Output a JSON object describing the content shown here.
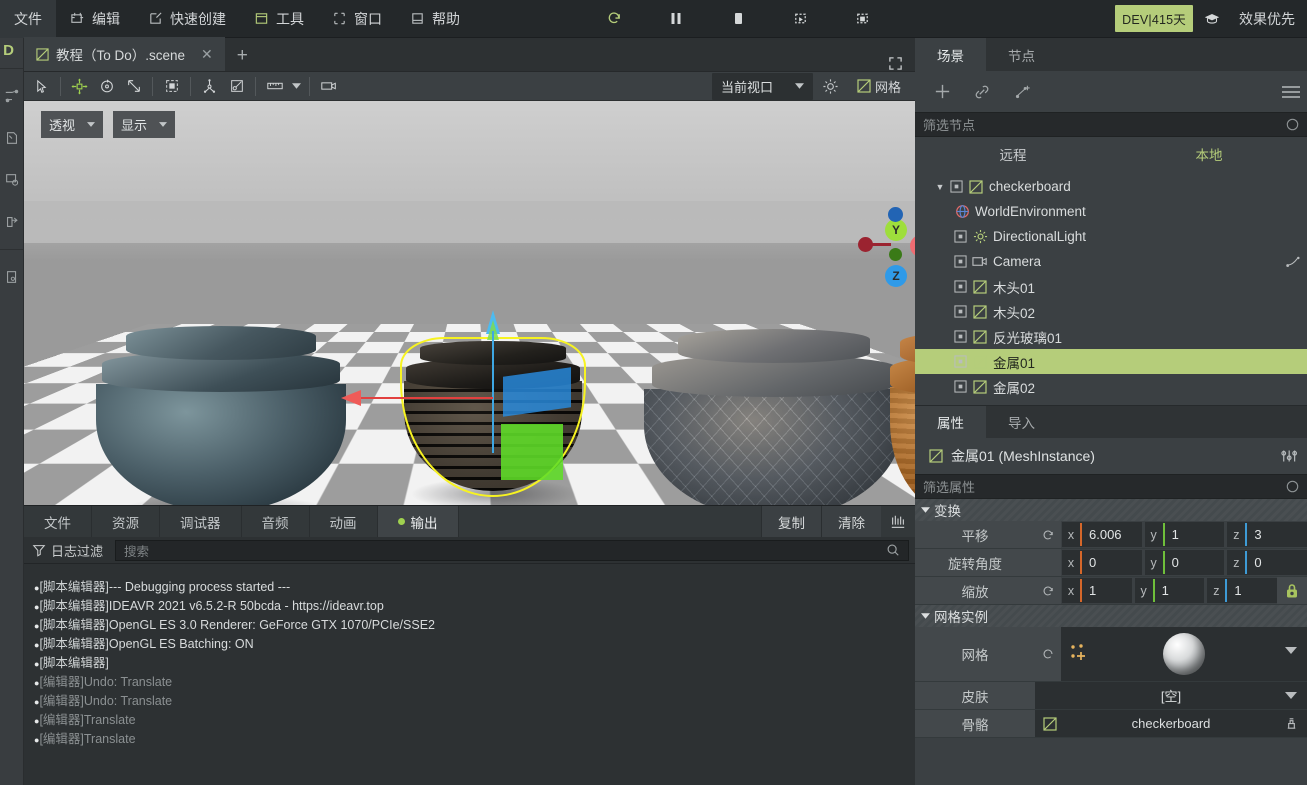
{
  "menu": {
    "items": [
      {
        "label": "文件",
        "icon": "none"
      },
      {
        "label": "编辑",
        "icon": "edit-icon"
      },
      {
        "label": "快速创建",
        "icon": "quick-create-icon"
      },
      {
        "label": "工具",
        "icon": "tools-icon"
      },
      {
        "label": "窗口",
        "icon": "window-icon"
      },
      {
        "label": "帮助",
        "icon": "help-icon"
      }
    ],
    "playback": [
      {
        "name": "reload-icon"
      },
      {
        "name": "pause-icon"
      },
      {
        "name": "stop-icon"
      },
      {
        "name": "play-scene-icon"
      },
      {
        "name": "play-custom-scene-icon"
      }
    ],
    "dev_badge": "DEV|415天",
    "graduation_icon": "graduation-cap-icon",
    "quality_label": "效果优先"
  },
  "left_rail": {
    "label": "D",
    "items": [
      {
        "name": "node-graph-icon"
      },
      {
        "name": "shape-icon"
      },
      {
        "name": "settings-icon"
      },
      {
        "name": "export-icon"
      },
      {
        "name": "document-icon"
      }
    ]
  },
  "scene_tab": {
    "title": "教程（To Do）.scene",
    "close_label": "✕",
    "add_label": "+",
    "expand_icon": "fullscreen-icon"
  },
  "viewport_toolbar": {
    "tools": [
      {
        "name": "select-tool",
        "active": false
      },
      {
        "name": "move-tool",
        "active": true
      },
      {
        "name": "rotate-tool",
        "active": false
      },
      {
        "name": "scale-tool",
        "active": false
      },
      {
        "name": "snap-tool",
        "active": false
      },
      {
        "name": "local-space-tool",
        "active": false
      },
      {
        "name": "lock-tool",
        "active": false
      },
      {
        "name": "ruler-tool",
        "active": false
      },
      {
        "name": "camera-tool",
        "active": false
      }
    ],
    "viewport_select": "当前视口",
    "settings_icon": "gear-icon",
    "grid_label": "网格"
  },
  "viewport": {
    "perspective_label": "透视",
    "display_label": "显示",
    "axis_gizmo": {
      "x": "X",
      "y": "Y",
      "z": "Z"
    },
    "objects": [
      {
        "name": "teal-metal-bowl"
      },
      {
        "name": "dark-grill-bowl-selected"
      },
      {
        "name": "stone-mosaic-bowl"
      },
      {
        "name": "wood-bowl"
      }
    ]
  },
  "bottom_panel": {
    "tabs": [
      {
        "label": "文件",
        "active": false,
        "dot": false
      },
      {
        "label": "资源",
        "active": false,
        "dot": false
      },
      {
        "label": "调试器",
        "active": false,
        "dot": false
      },
      {
        "label": "音频",
        "active": false,
        "dot": false
      },
      {
        "label": "动画",
        "active": false,
        "dot": false
      },
      {
        "label": "输出",
        "active": true,
        "dot": true
      }
    ],
    "copy_label": "复制",
    "clear_label": "清除",
    "download_icon": "download-icon",
    "log_filter_label": "日志过滤",
    "search_placeholder": "搜索",
    "log_lines": [
      {
        "tag": "[脚本编辑器]",
        "msg": "--- Debugging process started ---",
        "dim": false
      },
      {
        "tag": "[脚本编辑器]",
        "msg": "IDEAVR 2021 v6.5.2-R 50bcda - https://ideavr.top",
        "dim": false
      },
      {
        "tag": "[脚本编辑器]",
        "msg": "OpenGL ES 3.0 Renderer: GeForce GTX 1070/PCIe/SSE2",
        "dim": false
      },
      {
        "tag": "[脚本编辑器]",
        "msg": "OpenGL ES Batching: ON",
        "dim": false
      },
      {
        "tag": "[脚本编辑器]",
        "msg": "",
        "dim": false
      },
      {
        "tag": "[编辑器]",
        "msg": "Undo: Translate",
        "dim": true
      },
      {
        "tag": "[编辑器]",
        "msg": "Undo: Translate",
        "dim": true
      },
      {
        "tag": "[编辑器]",
        "msg": "Translate",
        "dim": true
      },
      {
        "tag": "[编辑器]",
        "msg": "Translate",
        "dim": true
      }
    ]
  },
  "scene_dock": {
    "tabs": [
      {
        "label": "场景",
        "active": true
      },
      {
        "label": "节点",
        "active": false
      }
    ],
    "toolbar_icons": [
      {
        "name": "add-node-icon",
        "glyph": "+"
      },
      {
        "name": "link-icon"
      },
      {
        "name": "add-child-node-icon"
      }
    ],
    "menu_icon": "hamburger-menu-icon",
    "filter_placeholder": "筛选节点",
    "filter_clear_icon": "clear-icon",
    "remote_label": "远程",
    "local_label": "本地",
    "tree": [
      {
        "label": "checkerboard",
        "depth": 0,
        "icon": "mesh-icon",
        "arrow": true,
        "vis": true,
        "selected": false,
        "right_icon": false
      },
      {
        "label": "WorldEnvironment",
        "depth": 1,
        "icon": "world-environment-icon",
        "arrow": false,
        "vis": false,
        "selected": false,
        "right_icon": false
      },
      {
        "label": "DirectionalLight",
        "depth": 1,
        "icon": "light-icon",
        "arrow": false,
        "vis": true,
        "selected": false,
        "right_icon": false
      },
      {
        "label": "Camera",
        "depth": 1,
        "icon": "camera-icon",
        "arrow": false,
        "vis": true,
        "selected": false,
        "right_icon": true
      },
      {
        "label": "木头01",
        "depth": 1,
        "icon": "mesh-icon",
        "arrow": false,
        "vis": true,
        "selected": false,
        "right_icon": false
      },
      {
        "label": "木头02",
        "depth": 1,
        "icon": "mesh-icon",
        "arrow": false,
        "vis": true,
        "selected": false,
        "right_icon": false
      },
      {
        "label": "反光玻璃01",
        "depth": 1,
        "icon": "mesh-icon",
        "arrow": false,
        "vis": true,
        "selected": false,
        "right_icon": false
      },
      {
        "label": "金属01",
        "depth": 1,
        "icon": "mesh-icon",
        "arrow": false,
        "vis": true,
        "selected": true,
        "right_icon": false
      },
      {
        "label": "金属02",
        "depth": 1,
        "icon": "mesh-icon",
        "arrow": false,
        "vis": true,
        "selected": false,
        "right_icon": false
      }
    ]
  },
  "inspector": {
    "tabs": [
      {
        "label": "属性",
        "active": true
      },
      {
        "label": "导入",
        "active": false
      }
    ],
    "node_icon": "mesh-icon",
    "node_title": "金属01 (MeshInstance)",
    "header_icon": "sliders-icon",
    "filter_placeholder": "筛选属性",
    "filter_clear_icon": "clear-icon",
    "sections": [
      {
        "title": "变换",
        "rows": [
          {
            "label": "平移",
            "reset": true,
            "axes": [
              {
                "axis": "x",
                "value": "6.006",
                "color": "#d5672a"
              },
              {
                "axis": "y",
                "value": "1",
                "color": "#6fbf3b"
              },
              {
                "axis": "z",
                "value": "3",
                "color": "#3e9bd6"
              }
            ],
            "lock": false
          },
          {
            "label": "旋转角度",
            "reset": false,
            "axes": [
              {
                "axis": "x",
                "value": "0",
                "color": "#d5672a"
              },
              {
                "axis": "y",
                "value": "0",
                "color": "#6fbf3b"
              },
              {
                "axis": "z",
                "value": "0",
                "color": "#3e9bd6"
              }
            ],
            "lock": false
          },
          {
            "label": "缩放",
            "reset": true,
            "axes": [
              {
                "axis": "x",
                "value": "1",
                "color": "#d5672a"
              },
              {
                "axis": "y",
                "value": "1",
                "color": "#6fbf3b"
              },
              {
                "axis": "z",
                "value": "1",
                "color": "#3e9bd6"
              }
            ],
            "lock": true
          }
        ]
      }
    ],
    "mesh_section": {
      "title": "网格实例",
      "mesh_label": "网格",
      "mesh_preview_icon": "sphere-preview",
      "mesh_dots_icon": "resource-dots-icon",
      "skin_label": "皮肤",
      "skin_value": "[空]",
      "skeleton_label": "骨骼",
      "skeleton_value": "checkerboard",
      "skeleton_icon": "mesh-icon",
      "skeleton_trail_icon": "skeleton-icon"
    }
  },
  "colors": {
    "accent_green": "#b5cd7a",
    "selection_outline": "#f7f321",
    "axis_x": "#e2403f",
    "axis_y": "#6fbf3b",
    "axis_z": "#3e9bd6"
  }
}
